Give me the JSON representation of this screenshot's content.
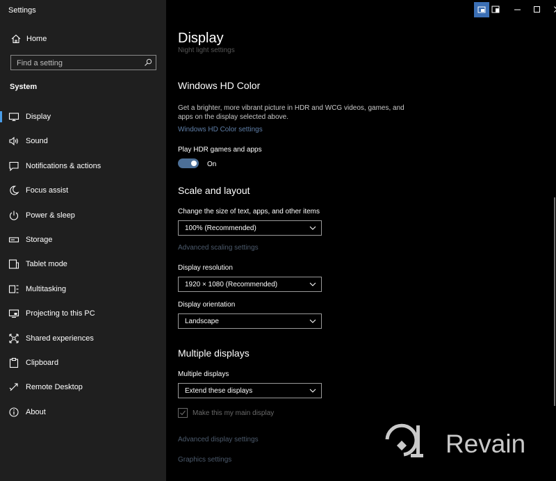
{
  "window": {
    "title": "Settings",
    "accent_color": "#4a9de8"
  },
  "sidebar": {
    "home_label": "Home",
    "search_placeholder": "Find a setting",
    "section_title": "System",
    "items": [
      {
        "label": "Display",
        "icon": "monitor-icon",
        "active": true
      },
      {
        "label": "Sound",
        "icon": "speaker-icon"
      },
      {
        "label": "Notifications & actions",
        "icon": "notification-icon"
      },
      {
        "label": "Focus assist",
        "icon": "moon-icon"
      },
      {
        "label": "Power & sleep",
        "icon": "power-icon"
      },
      {
        "label": "Storage",
        "icon": "storage-icon"
      },
      {
        "label": "Tablet mode",
        "icon": "tablet-icon"
      },
      {
        "label": "Multitasking",
        "icon": "multitasking-icon"
      },
      {
        "label": "Projecting to this PC",
        "icon": "projecting-icon"
      },
      {
        "label": "Shared experiences",
        "icon": "shared-icon"
      },
      {
        "label": "Clipboard",
        "icon": "clipboard-icon"
      },
      {
        "label": "Remote Desktop",
        "icon": "remote-desktop-icon"
      },
      {
        "label": "About",
        "icon": "info-icon"
      }
    ]
  },
  "main": {
    "page_title": "Display",
    "cut_link": "Night light settings",
    "hd_color": {
      "title": "Windows HD Color",
      "description": "Get a brighter, more vibrant picture in HDR and WCG videos, games, and apps on the display selected above.",
      "link": "Windows HD Color settings",
      "hdr_label": "Play HDR games and apps",
      "hdr_state": "On"
    },
    "scale": {
      "title": "Scale and layout",
      "size_label": "Change the size of text, apps, and other items",
      "size_value": "100% (Recommended)",
      "advanced_link": "Advanced scaling settings",
      "resolution_label": "Display resolution",
      "resolution_value": "1920 × 1080 (Recommended)",
      "orientation_label": "Display orientation",
      "orientation_value": "Landscape"
    },
    "multiple": {
      "title": "Multiple displays",
      "label": "Multiple displays",
      "value": "Extend these displays",
      "main_display_label": "Make this my main display",
      "advanced_link": "Advanced display settings",
      "graphics_link": "Graphics settings"
    }
  },
  "watermark": {
    "text": "Revain"
  }
}
